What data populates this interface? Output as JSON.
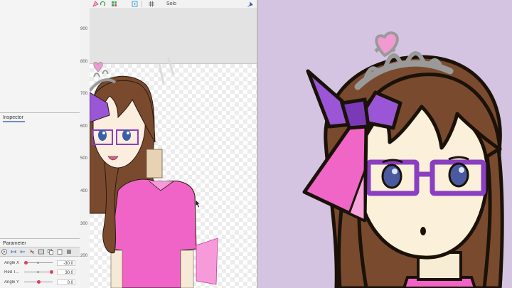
{
  "canvas_toolbar": {
    "solo_label": "Solo"
  },
  "panels": {
    "inspector_label": "Inspector",
    "parameter_label": "Parameter"
  },
  "ruler": {
    "marks": [
      "900",
      "800",
      "700",
      "600",
      "500",
      "400",
      "300",
      "200"
    ]
  },
  "parameters": [
    {
      "name": "Angle X",
      "value": "-30.0",
      "position": 0.0
    },
    {
      "name": "Red T...",
      "value": "30.0",
      "position": 1.0
    },
    {
      "name": "Angle Y",
      "value": "0.0",
      "position": 0.5
    }
  ],
  "colors": {
    "preview_background": "#d4c4e1",
    "hair": "#7a4a2e",
    "ribbon_purple": "#9a56d6",
    "ribbon_pink": "#ef66c6",
    "shirt_pink": "#f064c8",
    "glasses": "#8a3fc0",
    "tiara": "#9a9a9a",
    "heart": "#f19ad2"
  }
}
